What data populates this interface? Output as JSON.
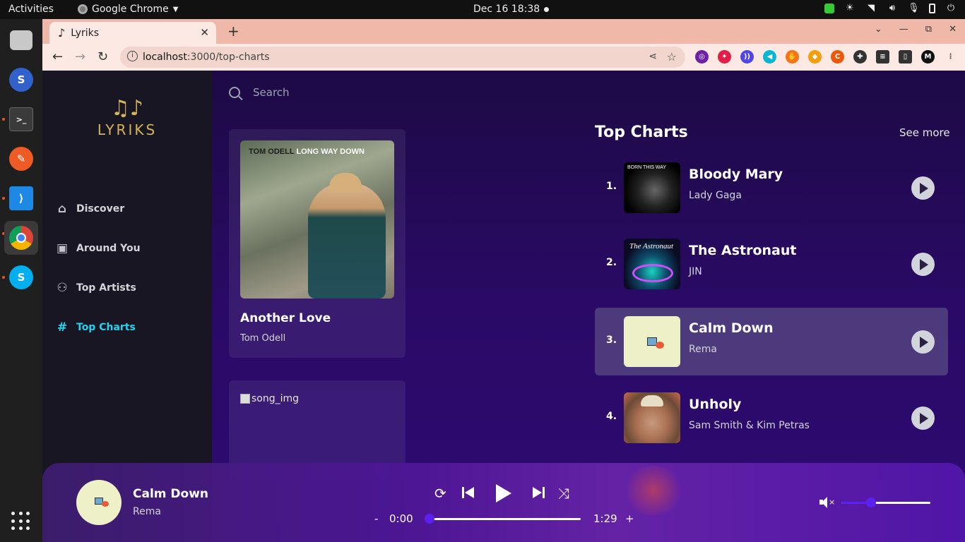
{
  "system": {
    "activities": "Activities",
    "app_menu": "Google Chrome",
    "clock": "Dec 16  18:38"
  },
  "browser": {
    "tab_title": "Lyriks",
    "url_host": "localhost",
    "url_rest": ":3000/top-charts"
  },
  "app": {
    "logo_text": "LYRIKS",
    "nav": [
      {
        "label": "Discover",
        "icon": "home-icon"
      },
      {
        "label": "Around You",
        "icon": "image-icon"
      },
      {
        "label": "Top Artists",
        "icon": "users-icon"
      },
      {
        "label": "Top Charts",
        "icon": "hash-icon",
        "active": true
      }
    ],
    "search_placeholder": "Search",
    "cards": [
      {
        "title": "Another Love",
        "artist": "Tom Odell",
        "art_caption_dark": "TOM ODELL",
        "art_caption_light": "LONG WAY DOWN"
      },
      {
        "img_alt": "song_img"
      }
    ],
    "top_charts": {
      "title": "Top Charts",
      "see_more": "See more",
      "rows": [
        {
          "rank": "1.",
          "title": "Bloody Mary",
          "artist": "Lady Gaga",
          "art_text": "BORN THIS WAY"
        },
        {
          "rank": "2.",
          "title": "The Astronaut",
          "artist": "JIN",
          "art_text": "The Astronaut"
        },
        {
          "rank": "3.",
          "title": "Calm Down",
          "artist": "Rema",
          "active": true
        },
        {
          "rank": "4.",
          "title": "Unholy",
          "artist": "Sam Smith & Kim Petras"
        }
      ]
    },
    "player": {
      "title": "Calm Down",
      "artist": "Rema",
      "minus": "-",
      "plus": "+",
      "current_time": "0:00",
      "duration": "1:29",
      "progress": 0,
      "volume": 0.33
    }
  },
  "colors": {
    "accent": "#22d3ee",
    "brand_gold": "#d5b455",
    "player_knob": "#5b21f0"
  }
}
